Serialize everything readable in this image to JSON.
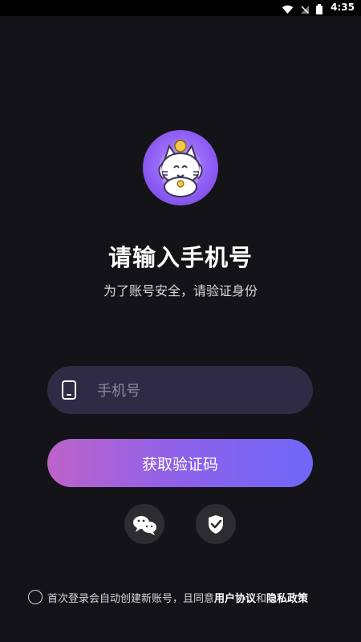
{
  "status": {
    "time": "4:35",
    "icons": [
      "wifi-icon",
      "signal-off-icon",
      "battery-icon"
    ]
  },
  "avatar": {
    "icon": "lucky-cat-avatar-icon"
  },
  "header": {
    "title": "请输入手机号",
    "subtitle": "为了账号安全，请验证身份"
  },
  "phone": {
    "placeholder": "手机号",
    "value": "",
    "icon": "phone-icon"
  },
  "actions": {
    "get_code_label": "获取验证码",
    "wechat_icon": "wechat-icon",
    "shield_icon": "shield-check-icon"
  },
  "agreement": {
    "prefix": "首次登录会自动创建新账号，且同意",
    "user_agreement": "用户协议",
    "connector": "和",
    "privacy_policy": "隐私政策"
  },
  "colors": {
    "background": "#141317",
    "input_bg": "#2f2b44",
    "button_gradient_start": "#bd63c8",
    "button_gradient_end": "#6f67f8"
  }
}
